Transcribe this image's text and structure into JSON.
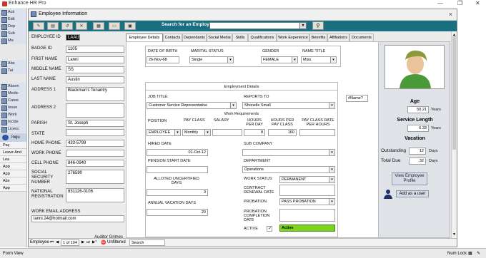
{
  "app": {
    "title": "Enhance HR Pro"
  },
  "nav": {
    "items_top": [
      "Acti",
      "Edit",
      "Dep",
      "Sub",
      "Ma"
    ],
    "items_mid": [
      "Abs",
      "Tar"
    ],
    "items_bot": [
      "Absen",
      "Medic",
      "Caree",
      "Issue",
      "Work",
      "Incide",
      "Licenc"
    ],
    "group": "Inqu",
    "plain": [
      "Pay",
      "Leave And",
      "Lea",
      "App",
      "App",
      "Abs",
      "App"
    ]
  },
  "form": {
    "title": "Employee Information",
    "close": "×",
    "toolbar": {
      "search_label": "Search for an Employee",
      "search_value": "",
      "go": "⚲"
    }
  },
  "left": {
    "employee_id_label": "EMPLOYEE ID",
    "employee_id": "LAAU01",
    "badge_id_label": "Badge ID",
    "badge_id": "1105",
    "first_name_label": "FIRST NAME",
    "first_name": "Lanni",
    "middle_name_label": "MIDDLE NAME",
    "middle_name": "SS",
    "last_name_label": "LAST NAME",
    "last_name": "Austin",
    "address1_label": "ADDRESS 1",
    "address1": "Blackman's Tenantry",
    "address2_label": "ADDRESS 2",
    "address2": "",
    "parish_label": "PARISH",
    "parish": "St. Joseph",
    "state_label": "STATE",
    "state": "",
    "home_phone_label": "HOME PHONE",
    "home_phone": "433-5799",
    "work_phone_label": "WORK PHONE",
    "work_phone": "",
    "cell_phone_label": "CELL PHONE",
    "cell_phone": "846-0940",
    "ssn_label": "SOCIAL SECURITY NUMBER",
    "ssn": "276590",
    "national_reg_label": "NATIONAL REGISTRATION",
    "national_reg": "831126-0106",
    "email_label": "WORK EMAIL ADDRESS",
    "email": "lanni.24@hotmail.com",
    "auditor_label": "Auditor Grimes"
  },
  "tabs": [
    "Employee Details",
    "Contacts",
    "Dependants",
    "Social Media",
    "Skills",
    "Qualifications",
    "Work Experience",
    "Benefits",
    "Affiliations",
    "Documents"
  ],
  "details": {
    "dob_label": "DATE OF BIRTH",
    "dob": "26-Nov-68",
    "marital_label": "MARITAL STATUS",
    "marital": "Single",
    "gender_label": "GENDER",
    "gender": "FEMALE",
    "name_title_label": "NAME TITLE",
    "name_title": "Miss.",
    "employment_details_label": "Employment Details",
    "job_title_label": "JOB TITLE:",
    "job_title": "Customer Service Representative",
    "reports_to_label": "REPORTS TO",
    "reports_to": "Shonelle Small",
    "work_req_label": "Work Requirements",
    "position_label": "POSITION",
    "position": "EMPLOYEE",
    "pay_class_label": "PAY CLASS",
    "pay_class": "Monthly",
    "salary_label": "SALARY",
    "salary": "",
    "hours_per_day_label": "HOURS PER DAY",
    "hours_per_day": "8",
    "hours_per_pay_label": "HOURS PER PAY CLASS",
    "hours_per_pay": "160",
    "flat_rate_label": "PAY CLASS RATE PER HOURS",
    "flat_rate": "",
    "hired_date_label": "HIRED DATE",
    "hired_date": "01-Oct-12",
    "sub_company_label": "SUB COMPANY",
    "sub_company": "",
    "pension_label": "PENSION START DATE",
    "pension": "",
    "department_label": "DEPARTMENT",
    "department": "Operations",
    "alloted_label": "ALLOTED UNCERTIFIED DAYS",
    "alloted": "3",
    "work_status_label": "WORK STATUS",
    "work_status": "PERMANENT",
    "contract_label": "CONTRACT RENEWAL DATE",
    "contract": "",
    "probation_label": "PROBATION",
    "probation": "PASS PROBATION",
    "annual_label": "ANNUAL VACATION DAYS",
    "annual": "20",
    "prob_completion_label": "PROBATION COMPLETION DATE",
    "prob_completion": "",
    "active_label": "ACTIVE",
    "active_check": "✓",
    "active_status": "Active",
    "name_error": "#Name?"
  },
  "right": {
    "age_label": "Age",
    "age": "50.21",
    "years": "Years",
    "service_label": "Service Length",
    "service": "6.33",
    "vacation_label": "Vacation",
    "outstanding_label": "Outstanding",
    "outstanding": "12",
    "total_label": "Total Due",
    "total": "32",
    "days": "Days",
    "view_profile": "View Employee Profile",
    "add_user": "Add as a user"
  },
  "recnav": {
    "label": "Employee",
    "first": "⏮",
    "prev": "◀",
    "position": "1 of 104",
    "next": "▶",
    "last": "⏭",
    "new": "▶*",
    "filter": "Unfiltered",
    "search": "Search"
  },
  "status": {
    "left": "Form View",
    "right": "Num Lock"
  },
  "colors": {
    "toolbar": "#1a7081",
    "active_green": "#7ed321"
  }
}
